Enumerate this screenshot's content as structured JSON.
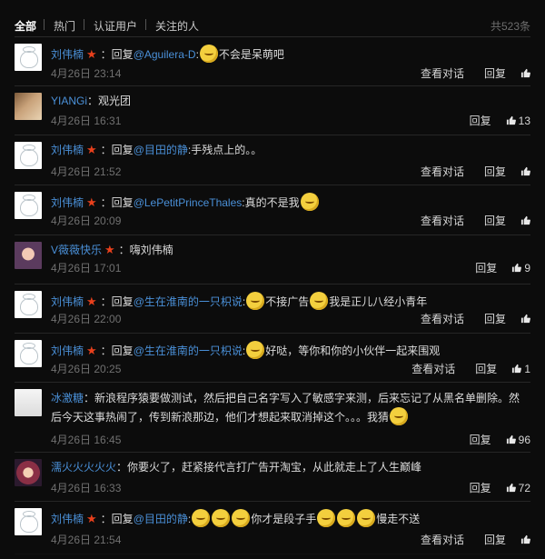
{
  "tabs": [
    "全部",
    "热门",
    "认证用户",
    "关注的人"
  ],
  "total": "共523条",
  "actions": {
    "view_conversation": "查看对话",
    "reply": "回复"
  },
  "comments": [
    {
      "user": "刘伟楠",
      "vip": true,
      "reply_prefix": "：回复",
      "mention": "@Aguilera-D",
      "segments": [
        ":",
        "[emoji]",
        "不会是呆萌吧"
      ],
      "time": "4月26日 23:14",
      "has_conversation": true,
      "likes": ""
    },
    {
      "user": "YIANGi",
      "vip": false,
      "reply_prefix": "",
      "mention": "",
      "segments": [
        "：观光团"
      ],
      "time": "4月26日 16:31",
      "has_conversation": false,
      "likes": "13"
    },
    {
      "user": "刘伟楠",
      "vip": true,
      "reply_prefix": "：回复",
      "mention": "@目田的静",
      "segments": [
        ":手残点上的。。"
      ],
      "time": "4月26日 21:52",
      "has_conversation": true,
      "likes": ""
    },
    {
      "user": "刘伟楠",
      "vip": true,
      "reply_prefix": "：回复",
      "mention": "@LePetitPrinceThales",
      "segments": [
        ":真的不是我",
        "[emoji]"
      ],
      "time": "4月26日 20:09",
      "has_conversation": true,
      "likes": ""
    },
    {
      "user": "V薇薇快乐",
      "vip": true,
      "reply_prefix": "",
      "mention": "",
      "segments": [
        "：嗨刘伟楠"
      ],
      "time": "4月26日 17:01",
      "has_conversation": false,
      "likes": "9"
    },
    {
      "user": "刘伟楠",
      "vip": true,
      "reply_prefix": "：回复",
      "mention": "@生在淮南的一只枳说",
      "segments": [
        ":",
        "[emoji]",
        "不接广告",
        "[emoji]",
        "我是正儿八经小青年"
      ],
      "time": "4月26日 22:00",
      "has_conversation": true,
      "likes": ""
    },
    {
      "user": "刘伟楠",
      "vip": true,
      "reply_prefix": "：回复",
      "mention": "@生在淮南的一只枳说",
      "segments": [
        ":",
        "[emoji]",
        "好哒，等你和你的小伙伴一起来围观"
      ],
      "time": "4月26日 20:25",
      "has_conversation": true,
      "likes": "1"
    },
    {
      "user": "冰激糖",
      "vip": false,
      "reply_prefix": "",
      "mention": "",
      "segments": [
        "：新浪程序猿要做测试，然后把自己名字写入了敏感字来测，后来忘记了从黑名单删除。然后今天这事热闹了，传到新浪那边，他们才想起来取消掉这个。。。我猜",
        "[emoji]"
      ],
      "time": "4月26日 16:45",
      "has_conversation": false,
      "likes": "96"
    },
    {
      "user": "濡火火火火火",
      "vip": false,
      "reply_prefix": "",
      "mention": "",
      "segments": [
        "：你要火了，赶紧接代言打广告开淘宝，从此就走上了人生巅峰"
      ],
      "time": "4月26日 16:33",
      "has_conversation": false,
      "likes": "72"
    },
    {
      "user": "刘伟楠",
      "vip": true,
      "reply_prefix": "：回复",
      "mention": "@目田的静",
      "segments": [
        ":",
        "[emoji]",
        "[emoji]",
        "[emoji]",
        "你才是段子手",
        "[emoji]",
        "[emoji]",
        "[emoji]",
        "慢走不送"
      ],
      "time": "4月26日 21:54",
      "has_conversation": true,
      "likes": ""
    }
  ]
}
